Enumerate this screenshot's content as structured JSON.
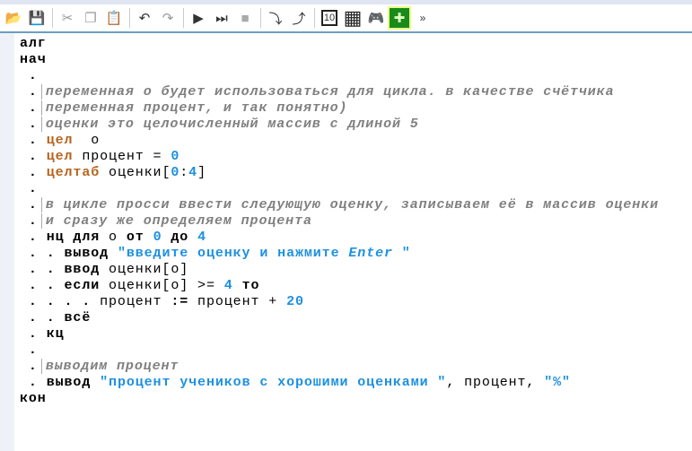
{
  "toolbar": {
    "items": [
      {
        "name": "open-icon",
        "glyph": "📂"
      },
      {
        "name": "save-icon",
        "glyph": "💾"
      },
      {
        "sep": true
      },
      {
        "name": "cut-icon",
        "glyph": "✂"
      },
      {
        "name": "copy-icon",
        "glyph": "❐"
      },
      {
        "name": "paste-icon",
        "glyph": "📋"
      },
      {
        "sep": true
      },
      {
        "name": "undo-icon",
        "glyph": "↶"
      },
      {
        "name": "redo-icon",
        "glyph": "↷"
      },
      {
        "sep": true
      },
      {
        "name": "run-icon",
        "glyph": "▶"
      },
      {
        "name": "run-step-icon",
        "glyph": "⏭"
      },
      {
        "name": "stop-icon",
        "glyph": "■"
      },
      {
        "sep": true
      },
      {
        "name": "step-into-icon",
        "glyph": "⤵"
      },
      {
        "name": "step-out-icon",
        "glyph": "⤴"
      },
      {
        "sep": true
      },
      {
        "name": "counter-icon",
        "glyph": "10"
      },
      {
        "name": "grid-icon",
        "glyph": "▦"
      },
      {
        "name": "robot-icon",
        "glyph": "🎮"
      },
      {
        "name": "drawer-icon",
        "glyph": "✚"
      },
      {
        "name": "more-icon",
        "glyph": "»"
      }
    ]
  },
  "code": [
    [
      [
        "kw",
        "алг"
      ]
    ],
    [
      [
        "kw",
        "нач"
      ]
    ],
    [
      [
        "dot",
        " ."
      ]
    ],
    [
      [
        "dot",
        " ."
      ],
      [
        "cm",
        "переменная о будет использоваться для цикла. в качестве счётчика"
      ]
    ],
    [
      [
        "dot",
        " ."
      ],
      [
        "cm",
        "переменная процент, и так понятно)"
      ]
    ],
    [
      [
        "dot",
        " ."
      ],
      [
        "cm",
        "оценки это целочисленный массив с длиной 5"
      ]
    ],
    [
      [
        "dot",
        " . "
      ],
      [
        "ty",
        "цел"
      ],
      [
        "",
        "  о"
      ]
    ],
    [
      [
        "dot",
        " . "
      ],
      [
        "ty",
        "цел"
      ],
      [
        "",
        " процент = "
      ],
      [
        "num",
        "0"
      ]
    ],
    [
      [
        "dot",
        " . "
      ],
      [
        "ty",
        "целтаб"
      ],
      [
        "",
        " оценки["
      ],
      [
        "num",
        "0"
      ],
      [
        "",
        ":"
      ],
      [
        "num",
        "4"
      ],
      [
        "",
        "]"
      ]
    ],
    [
      [
        "dot",
        " ."
      ]
    ],
    [
      [
        "dot",
        " ."
      ],
      [
        "cm",
        "в цикле просси ввести следующую оценку, записываем её в массив оценки"
      ]
    ],
    [
      [
        "dot",
        " ."
      ],
      [
        "cm",
        "и сразу же определяем процента"
      ]
    ],
    [
      [
        "dot",
        " . "
      ],
      [
        "kw",
        "нц для"
      ],
      [
        "",
        " о "
      ],
      [
        "kw",
        "от"
      ],
      [
        "",
        " "
      ],
      [
        "num",
        "0"
      ],
      [
        "",
        " "
      ],
      [
        "kw",
        "до"
      ],
      [
        "",
        " "
      ],
      [
        "num",
        "4"
      ]
    ],
    [
      [
        "dot",
        " . . "
      ],
      [
        "kw",
        "вывод"
      ],
      [
        "",
        " "
      ],
      [
        "str",
        "\"введите оценку и нажмите "
      ],
      [
        "stri",
        "Enter"
      ],
      [
        "str",
        " \""
      ]
    ],
    [
      [
        "dot",
        " . . "
      ],
      [
        "kw",
        "ввод"
      ],
      [
        "",
        " оценки[о]"
      ]
    ],
    [
      [
        "dot",
        " . . "
      ],
      [
        "kw",
        "если"
      ],
      [
        "",
        " оценки[о] >= "
      ],
      [
        "num",
        "4"
      ],
      [
        "",
        " "
      ],
      [
        "kw",
        "то"
      ]
    ],
    [
      [
        "dot",
        " . . . . "
      ],
      [
        "",
        "процент "
      ],
      [
        "kw",
        ":="
      ],
      [
        "",
        " процент + "
      ],
      [
        "num",
        "20"
      ]
    ],
    [
      [
        "dot",
        " . . "
      ],
      [
        "kw",
        "всё"
      ]
    ],
    [
      [
        "dot",
        " . "
      ],
      [
        "kw",
        "кц"
      ]
    ],
    [
      [
        "dot",
        " ."
      ]
    ],
    [
      [
        "dot",
        " ."
      ],
      [
        "cm",
        "выводим процент"
      ]
    ],
    [
      [
        "dot",
        " . "
      ],
      [
        "kw",
        "вывод"
      ],
      [
        "",
        " "
      ],
      [
        "str",
        "\"процент учеников с хорошими оценками \""
      ],
      [
        "",
        ", процент, "
      ],
      [
        "str",
        "\"%\""
      ]
    ],
    [
      [
        "kw",
        "кон"
      ]
    ]
  ]
}
